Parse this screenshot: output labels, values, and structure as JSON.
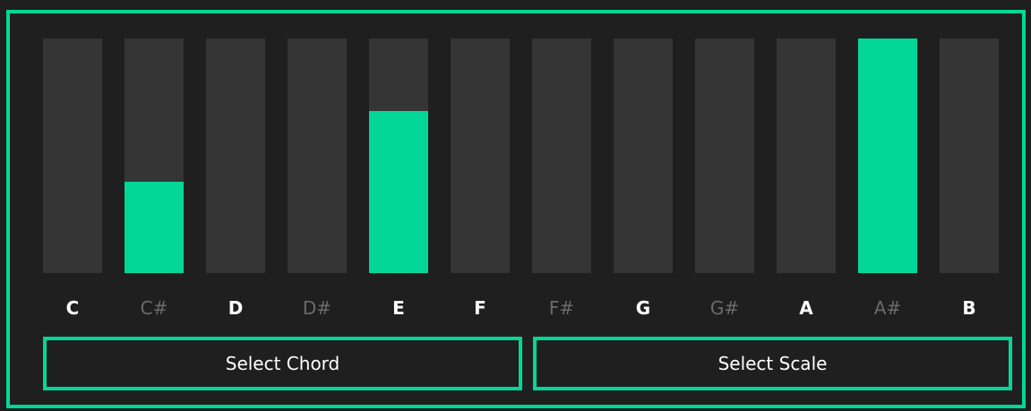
{
  "colors": {
    "accent": "#03d797",
    "bar_background": "#353535",
    "panel_background": "#1f1f1f",
    "natural_label": "#ffffff",
    "sharp_label": "#6b6b6b"
  },
  "notes": [
    {
      "label": "C",
      "sharp": false,
      "level": 0
    },
    {
      "label": "C#",
      "sharp": true,
      "level": 0.39
    },
    {
      "label": "D",
      "sharp": false,
      "level": 0
    },
    {
      "label": "D#",
      "sharp": true,
      "level": 0
    },
    {
      "label": "E",
      "sharp": false,
      "level": 0.69
    },
    {
      "label": "F",
      "sharp": false,
      "level": 0
    },
    {
      "label": "F#",
      "sharp": true,
      "level": 0
    },
    {
      "label": "G",
      "sharp": false,
      "level": 0
    },
    {
      "label": "G#",
      "sharp": true,
      "level": 0
    },
    {
      "label": "A",
      "sharp": false,
      "level": 0
    },
    {
      "label": "A#",
      "sharp": true,
      "level": 1.0
    },
    {
      "label": "B",
      "sharp": false,
      "level": 0
    }
  ],
  "buttons": {
    "select_chord": "Select Chord",
    "select_scale": "Select Scale"
  }
}
